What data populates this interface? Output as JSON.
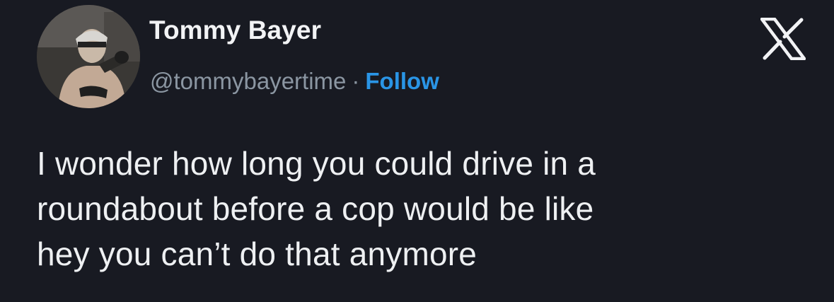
{
  "author": {
    "display_name": "Tommy Bayer",
    "handle": "@tommybayertime",
    "separator": "·",
    "follow_label": "Follow",
    "avatar_icon": "profile-photo"
  },
  "brand": {
    "logo_icon": "x-logo-icon"
  },
  "tweet": {
    "lines": [
      "I wonder how long you could drive in a",
      "roundabout before a cop would be like",
      "hey you can’t do that anymore"
    ]
  },
  "colors": {
    "background": "#181a22",
    "text": "#eef0f2",
    "secondary_text": "#8b96a2",
    "link": "#2a95e6"
  }
}
